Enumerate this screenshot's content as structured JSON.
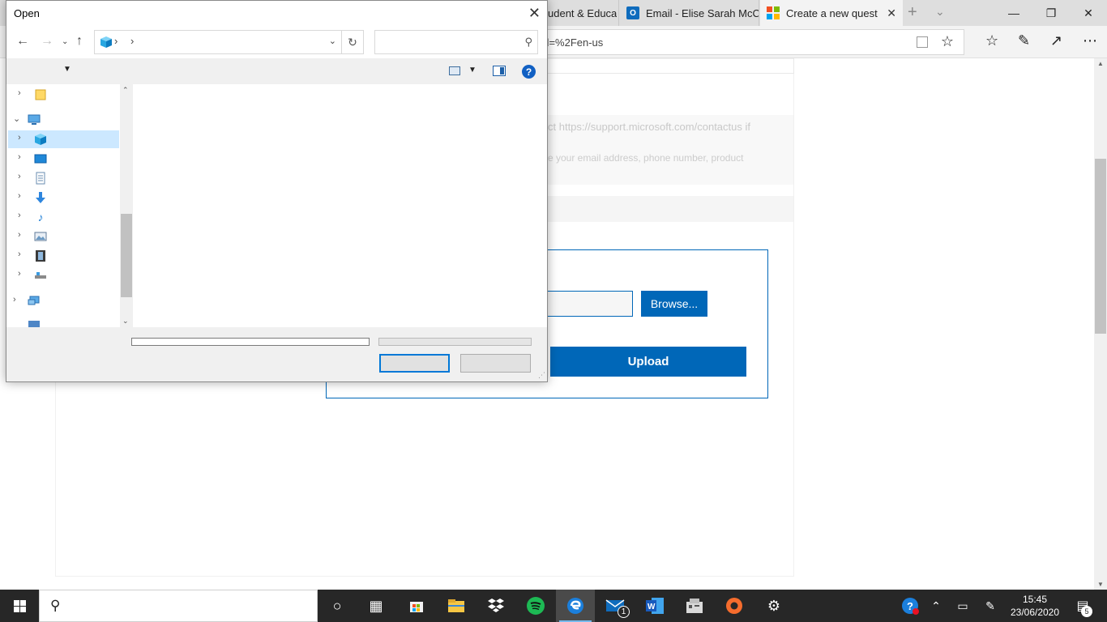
{
  "browser": {
    "tabs": [
      {
        "label": "udent & Educa"
      },
      {
        "label": "Email - Elise Sarah McC",
        "icon": "outlook-icon"
      },
      {
        "label": "Create a new quest",
        "icon": "microsoft-logo-icon",
        "active": true
      }
    ],
    "address": "url=%2Fen-us",
    "tab_close_glyph": "✕",
    "new_tab_glyph": "+"
  },
  "page": {
    "info_line1": "ct https://support.microsoft.com/contactus if",
    "info_line2": "e your email address, phone number, product",
    "browse_label": "Browse...",
    "upload_label": "Upload",
    "accent": "#0067b8"
  },
  "dialog": {
    "title": "Open",
    "search_placeholder": "",
    "nav_items": [
      {
        "icon": "folder-icon",
        "expanded": false
      },
      {
        "icon": "this-pc-icon",
        "expanded": true
      },
      {
        "icon": "3d-objects-icon",
        "expanded": false,
        "selected": true
      },
      {
        "icon": "desktop-icon",
        "expanded": false
      },
      {
        "icon": "documents-icon",
        "expanded": false
      },
      {
        "icon": "downloads-icon",
        "expanded": false
      },
      {
        "icon": "music-icon",
        "expanded": false
      },
      {
        "icon": "pictures-icon",
        "expanded": false
      },
      {
        "icon": "videos-icon",
        "expanded": false
      },
      {
        "icon": "drive-icon",
        "expanded": false
      },
      {
        "icon": "network-icon",
        "expanded": false
      },
      {
        "icon": "control-panel-icon",
        "expanded": false
      }
    ],
    "accent": "#0078d7",
    "help_glyph": "?"
  },
  "taskbar": {
    "mail_badge": "1",
    "clock_time": "15:45",
    "clock_date": "23/06/2020",
    "notification_count": "5",
    "apps": [
      "cortana-icon",
      "task-view-icon",
      "store-icon",
      "file-explorer-icon",
      "dropbox-icon",
      "spotify-icon",
      "edge-icon",
      "mail-icon",
      "word-icon",
      "app-icon",
      "origin-icon",
      "settings-icon"
    ]
  }
}
